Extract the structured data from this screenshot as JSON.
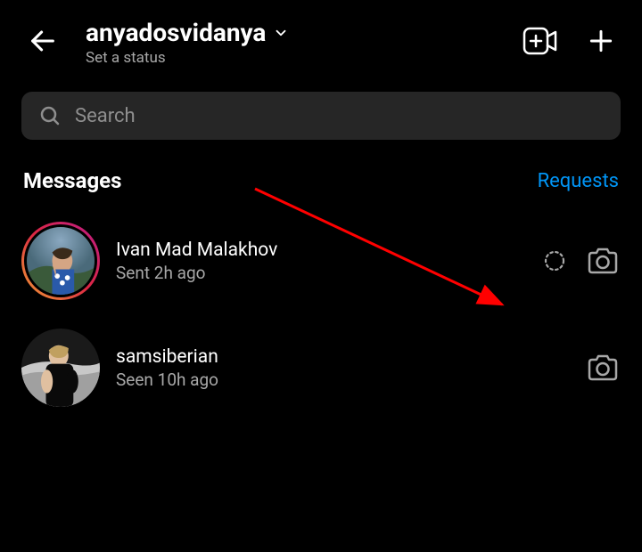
{
  "header": {
    "username": "anyadosvidanya",
    "status": "Set a status"
  },
  "search": {
    "placeholder": "Search"
  },
  "section": {
    "title": "Messages",
    "requests_label": "Requests"
  },
  "messages": [
    {
      "name": "Ivan Mad Malakhov",
      "status": "Sent 2h ago",
      "has_story": true,
      "has_disappearing": true
    },
    {
      "name": "samsiberian",
      "status": "Seen 10h ago",
      "has_story": false,
      "has_disappearing": false
    }
  ]
}
